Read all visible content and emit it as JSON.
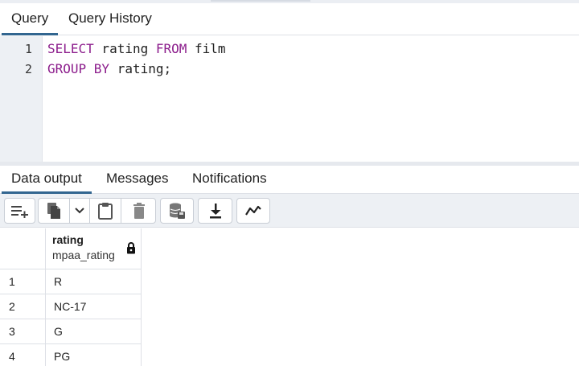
{
  "query_tabs": [
    {
      "label": "Query",
      "active": true
    },
    {
      "label": "Query History",
      "active": false
    }
  ],
  "editor": {
    "line_numbers": [
      "1",
      "2"
    ],
    "lines": [
      [
        {
          "t": "SELECT",
          "kw": true
        },
        {
          "t": " rating ",
          "kw": false
        },
        {
          "t": "FROM",
          "kw": true
        },
        {
          "t": " film",
          "kw": false
        }
      ],
      [
        {
          "t": "GROUP BY",
          "kw": true
        },
        {
          "t": " rating;",
          "kw": false
        }
      ]
    ]
  },
  "output_tabs": [
    {
      "label": "Data output",
      "active": true
    },
    {
      "label": "Messages",
      "active": false
    },
    {
      "label": "Notifications",
      "active": false
    }
  ],
  "toolbar": {
    "buttons": [
      "add-row-icon",
      "copy-icon",
      "chevron-down-icon",
      "paste-icon",
      "delete-icon",
      "save-data-icon",
      "download-icon",
      "graph-icon"
    ]
  },
  "grid": {
    "column": {
      "name": "rating",
      "type": "mpaa_rating",
      "locked": true
    },
    "rows": [
      {
        "num": "1",
        "value": "R"
      },
      {
        "num": "2",
        "value": "NC-17"
      },
      {
        "num": "3",
        "value": "G"
      },
      {
        "num": "4",
        "value": "PG"
      }
    ]
  },
  "colors": {
    "accent": "#326690",
    "keyword": "#8c1d8c",
    "panel_bg": "#edf0f4"
  }
}
